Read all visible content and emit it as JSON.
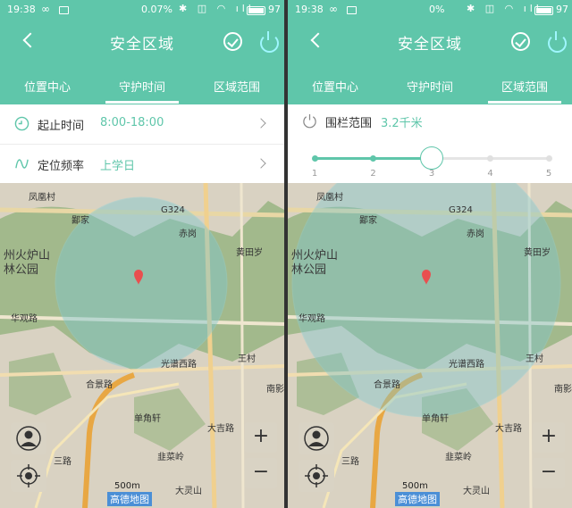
{
  "status_left": {
    "time": "19:38",
    "rate": "0.07",
    "rate_unit": "%",
    "battery": "97"
  },
  "status_right": {
    "time": "19:38",
    "rate": "0",
    "rate_unit": "%",
    "battery": "97"
  },
  "header": {
    "title": "安全区域"
  },
  "tabs": [
    {
      "label": "位置中心"
    },
    {
      "label": "守护时间"
    },
    {
      "label": "区域范围"
    }
  ],
  "left_tab_active": 1,
  "right_tab_active": 2,
  "guard_rows": [
    {
      "label": "起止时间",
      "value": "8:00-18:00",
      "icon": "clock-icon"
    },
    {
      "label": "定位频率",
      "value": "上学日",
      "icon": "wave-icon"
    }
  ],
  "range": {
    "label": "围栏范围",
    "value": "3.2千米",
    "ticks": [
      "1",
      "2",
      "3",
      "4",
      "5"
    ],
    "level": 3
  },
  "map": {
    "labels": {
      "hill": "州火炉山",
      "forest": "林公园",
      "road1": "华观路",
      "road2": "光谱西路",
      "road3": "合景路",
      "place1": "单角轩",
      "place2": "大吉路",
      "place3": "韭菜岭",
      "place4": "大灵山",
      "place5": "三路",
      "place6": "赤岗",
      "place7": "南影",
      "place8": "王村",
      "place9": "鄙家",
      "place10": "凤凰村",
      "place11": "黄田岁",
      "road_g": "G324"
    },
    "scale": "500m",
    "brand": "高德地图"
  },
  "colors": {
    "accent": "#5fc6aa",
    "power": "#9ff6ff"
  }
}
